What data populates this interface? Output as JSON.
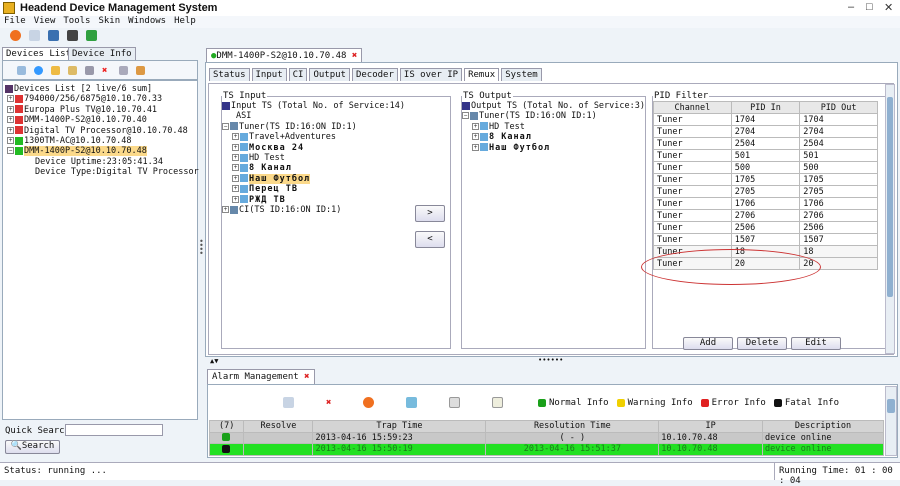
{
  "app": {
    "title": "Headend Device Management System"
  },
  "menu": [
    "File",
    "View",
    "Tools",
    "Skin",
    "Windows",
    "Help"
  ],
  "left_tabs": [
    "Devices List",
    "Device Info"
  ],
  "devices": {
    "root": "Devices List [2 live/6 sum]",
    "items": [
      {
        "label": "794000/256/6875@10.10.70.33",
        "status": "offline"
      },
      {
        "label": "Europa Plus TV@10.10.70.41",
        "status": "offline"
      },
      {
        "label": "DMM-1400P-S2@10.10.70.40",
        "status": "offline"
      },
      {
        "label": "Digital TV Processor@10.10.70.48",
        "status": "offline"
      },
      {
        "label": "1300TM-AC@10.10.70.48",
        "status": "online"
      },
      {
        "label": "DMM-1400P-S2@10.10.70.48",
        "status": "online"
      }
    ],
    "details": [
      "Device Uptime:23:05:41.34",
      "Device Type:Digital TV Processor"
    ]
  },
  "quick_search": {
    "label": "Quick Search",
    "value": "",
    "button": "Search"
  },
  "doc_tab": "DMM-1400P-S2@10.10.70.48",
  "sub_tabs": [
    "Status",
    "Input",
    "CI",
    "Output",
    "Decoder",
    "IS over IP",
    "Remux",
    "System"
  ],
  "active_sub_tab": "Remux",
  "ts_input": {
    "legend": "TS Input",
    "root": "Input TS (Total No. of Service:14)",
    "asi": "ASI",
    "tuner": "Tuner(TS ID:16:ON ID:1)",
    "services": [
      "Travel+Adventures",
      "Москва 24",
      "HD Test",
      "8 Канал",
      "Наш Футбол",
      "Перец ТВ",
      "РЖД ТВ"
    ],
    "selected": "Наш Футбол",
    "ci": "CI(TS ID:16:ON ID:1)"
  },
  "ts_output": {
    "legend": "TS Output",
    "root": "Output TS (Total No. of Service:3)",
    "tuner": "Tuner(TS ID:16:ON ID:1)",
    "services": [
      "HD Test",
      "8 Канал",
      "Наш Футбол"
    ]
  },
  "move_buttons": {
    "add": ">",
    "remove": "<"
  },
  "pid_filter": {
    "legend": "PID Filter",
    "columns": [
      "Channel",
      "PID In",
      "PID Out"
    ],
    "rows": [
      [
        "Tuner",
        "1704",
        "1704"
      ],
      [
        "Tuner",
        "2704",
        "2704"
      ],
      [
        "Tuner",
        "2504",
        "2504"
      ],
      [
        "Tuner",
        "501",
        "501"
      ],
      [
        "Tuner",
        "500",
        "500"
      ],
      [
        "Tuner",
        "1705",
        "1705"
      ],
      [
        "Tuner",
        "2705",
        "2705"
      ],
      [
        "Tuner",
        "1706",
        "1706"
      ],
      [
        "Tuner",
        "2706",
        "2706"
      ],
      [
        "Tuner",
        "2506",
        "2506"
      ],
      [
        "Tuner",
        "1507",
        "1507"
      ],
      [
        "Tuner",
        "18",
        "18"
      ],
      [
        "Tuner",
        "20",
        "20"
      ]
    ],
    "buttons": [
      "Add",
      "Delete",
      "Edit"
    ]
  },
  "alarm": {
    "tab": "Alarm Management",
    "legend": [
      {
        "label": "Normal Info",
        "color": "#1aa01a"
      },
      {
        "label": "Warning Info",
        "color": "#f0d000"
      },
      {
        "label": "Error Info",
        "color": "#e02020"
      },
      {
        "label": "Fatal Info",
        "color": "#111111"
      }
    ],
    "columns": [
      "(7)",
      "Resolve",
      "Trap Time",
      "Resolution Time",
      "IP",
      "Description"
    ],
    "rows": [
      {
        "level": "normal",
        "resolve": "",
        "trap": "2013-04-16 15:59:23",
        "resolution": "( - )",
        "ip": "10.10.70.48",
        "desc": "device online"
      },
      {
        "level": "fatal",
        "resolve": "",
        "trap": "2013-04-16 15:50:19",
        "resolution": "2013-04-16 15:51:37",
        "ip": "10.10.70.48",
        "desc": "device online"
      }
    ]
  },
  "status": {
    "left": "Status: running ...",
    "right": "Running Time: 01 : 00 : 04"
  }
}
